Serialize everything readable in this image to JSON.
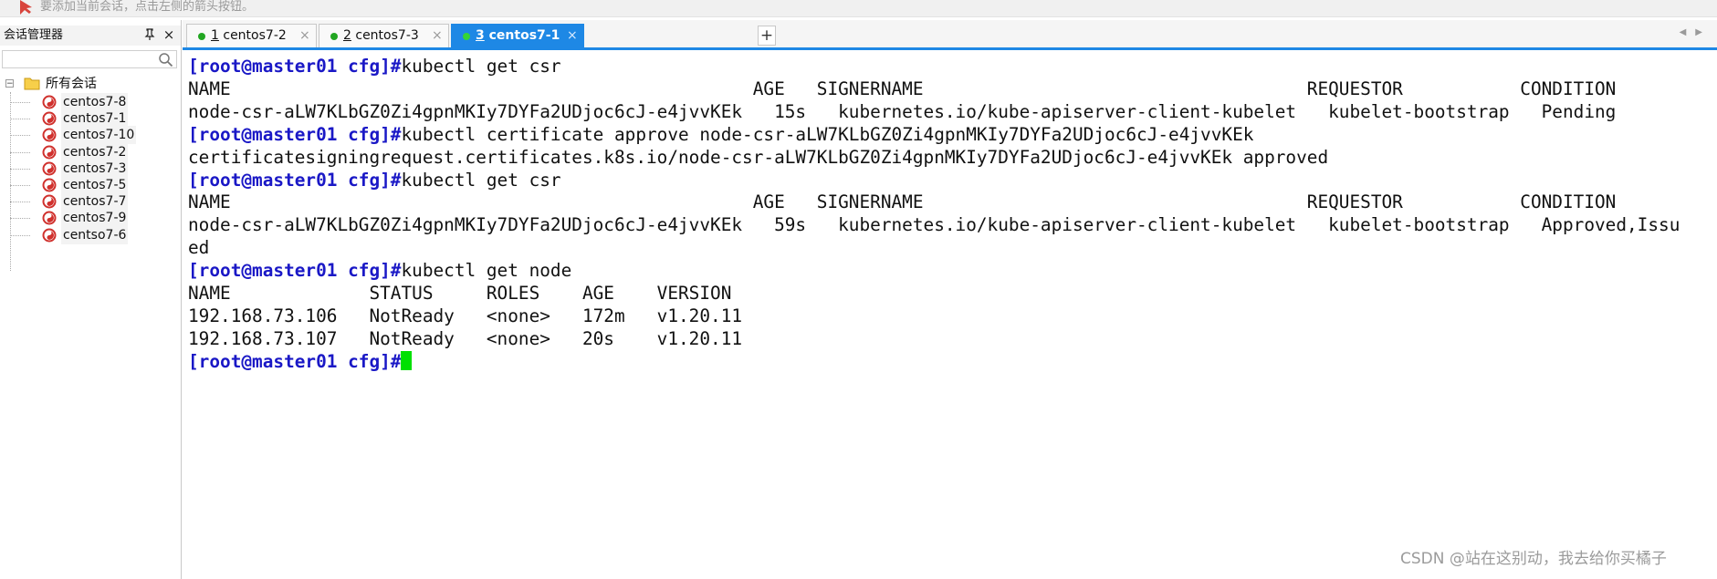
{
  "hint_bar": {
    "text": "要添加当前会话，点击左侧的箭头按钮。"
  },
  "session_panel": {
    "title": "会话管理器",
    "pin_glyph": "📌",
    "close_glyph": "×",
    "root_expander": "⊟",
    "root_label": "所有会话",
    "sessions": [
      "centos7-8",
      "centos7-1",
      "centos7-10",
      "centos7-2",
      "centos7-3",
      "centos7-5",
      "centos7-7",
      "centos7-9",
      "centso7-6"
    ]
  },
  "tabs": [
    {
      "num": "1",
      "name": "centos7-2",
      "active": false
    },
    {
      "num": "2",
      "name": "centos7-3",
      "active": false
    },
    {
      "num": "3",
      "name": "centos7-1",
      "active": true
    }
  ],
  "tab_close_glyph": "×",
  "add_tab_glyph": "+",
  "terminal": {
    "prompt": "[root@master01 cfg]#",
    "lines": [
      {
        "prompt": true,
        "text": "kubectl get csr"
      },
      {
        "prompt": false,
        "text": "NAME                                                 AGE   SIGNERNAME                                    REQUESTOR           CONDITION"
      },
      {
        "prompt": false,
        "text": "node-csr-aLW7KLbGZ0Zi4gpnMKIy7DYFa2UDjoc6cJ-e4jvvKEk   15s   kubernetes.io/kube-apiserver-client-kubelet   kubelet-bootstrap   Pending"
      },
      {
        "prompt": true,
        "text": "kubectl certificate approve node-csr-aLW7KLbGZ0Zi4gpnMKIy7DYFa2UDjoc6cJ-e4jvvKEk"
      },
      {
        "prompt": false,
        "text": "certificatesigningrequest.certificates.k8s.io/node-csr-aLW7KLbGZ0Zi4gpnMKIy7DYFa2UDjoc6cJ-e4jvvKEk approved"
      },
      {
        "prompt": true,
        "text": "kubectl get csr"
      },
      {
        "prompt": false,
        "text": "NAME                                                 AGE   SIGNERNAME                                    REQUESTOR           CONDITION"
      },
      {
        "prompt": false,
        "text": "node-csr-aLW7KLbGZ0Zi4gpnMKIy7DYFa2UDjoc6cJ-e4jvvKEk   59s   kubernetes.io/kube-apiserver-client-kubelet   kubelet-bootstrap   Approved,Issu"
      },
      {
        "prompt": false,
        "text": "ed"
      },
      {
        "prompt": true,
        "text": "kubectl get node"
      },
      {
        "prompt": false,
        "text": "NAME             STATUS     ROLES    AGE    VERSION"
      },
      {
        "prompt": false,
        "text": "192.168.73.106   NotReady   <none>   172m   v1.20.11"
      },
      {
        "prompt": false,
        "text": "192.168.73.107   NotReady   <none>   20s    v1.20.11"
      },
      {
        "prompt": true,
        "text": "",
        "cursor": true
      }
    ],
    "colors": {
      "prompt": "#1a18c6",
      "text": "#111111",
      "cursor": "#00e000"
    }
  },
  "watermark": "CSDN @站在这别动，我去给你买橘子",
  "colors": {
    "accent": "#1e88e5",
    "tab_dot": "#22a622"
  }
}
